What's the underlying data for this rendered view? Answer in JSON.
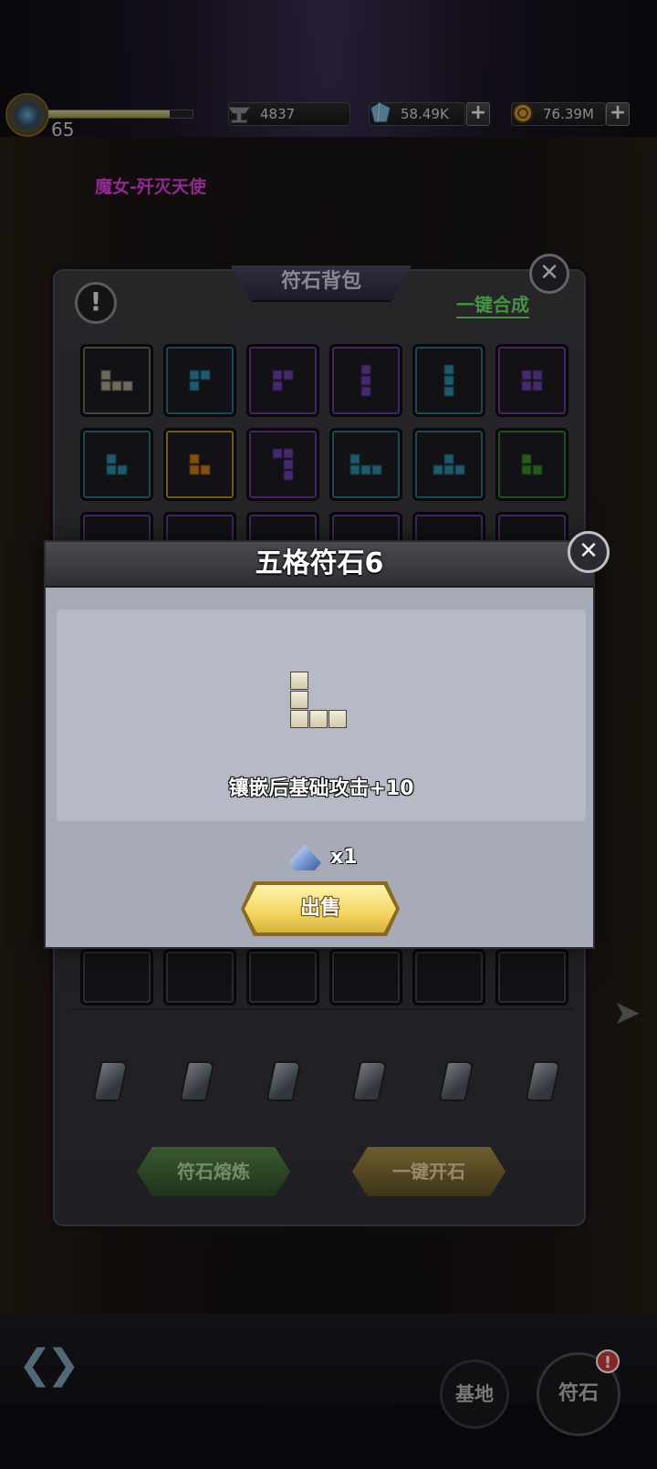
{
  "player": {
    "level": "65",
    "exp_fraction": 0.84
  },
  "resources": [
    {
      "name": "ore",
      "icon": "anvil-icon",
      "value": "4837"
    },
    {
      "name": "crystal",
      "icon": "crystal-icon",
      "value": "58.49K"
    },
    {
      "name": "coin",
      "icon": "coin-icon",
      "value": "76.39M"
    }
  ],
  "marquee": "魔女-歼灭天使",
  "bag": {
    "title": "符石背包",
    "merge_label": "一键合成",
    "info_label": "!",
    "close_label": "✕",
    "refine_label": "符石熔炼",
    "open_label": "一键开石",
    "slots": [
      {
        "color": "#a8a28e",
        "border": "#6f6a5a"
      },
      {
        "color": "#2e8aa8",
        "border": "#2a6e86"
      },
      {
        "color": "#6e3fa8",
        "border": "#6a3a96"
      },
      {
        "color": "#6e3fa8",
        "border": "#6a3a96"
      },
      {
        "color": "#2e8aa8",
        "border": "#2a6e86"
      },
      {
        "color": "#6e3fa8",
        "border": "#6a3a96"
      },
      {
        "color": "#2e8aa8",
        "border": "#2a6e86"
      },
      {
        "color": "#c67a1a",
        "border": "#b08a2a"
      },
      {
        "color": "#6e3fa8",
        "border": "#6a3a96"
      },
      {
        "color": "#2e8aa8",
        "border": "#2a6e86"
      },
      {
        "color": "#2e8aa8",
        "border": "#2a6e86"
      },
      {
        "color": "#3a8a2a",
        "border": "#2f7a2f"
      },
      {
        "color": "#6e3fa8",
        "border": "#6a3a96"
      },
      {
        "color": "#6e3fa8",
        "border": "#6a3a96"
      },
      {
        "color": "#6e3fa8",
        "border": "#6a3a96"
      },
      {
        "color": "#6e3fa8",
        "border": "#6a3a96"
      },
      {
        "color": "#6e3fa8",
        "border": "#6a3a96"
      },
      {
        "color": "#6e3fa8",
        "border": "#6a3a96"
      }
    ]
  },
  "detail": {
    "title": "五格符石6",
    "effect": "镶嵌后基础攻击+10",
    "reward_icon": "crystal-icon",
    "reward_count": "x1",
    "sell_label": "出售",
    "close_label": "✕"
  },
  "nav": {
    "base_label": "基地",
    "rune_label": "符石",
    "rune_badge": "!"
  }
}
